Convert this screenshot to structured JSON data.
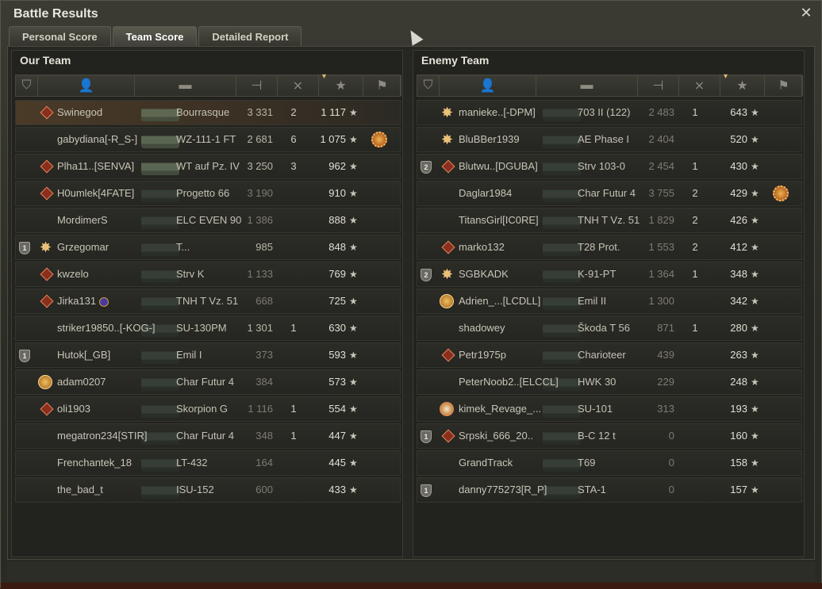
{
  "window": {
    "title": "Battle Results",
    "close_label": "✕"
  },
  "tabs": [
    {
      "label": "Personal Score"
    },
    {
      "label": "Team Score",
      "active": true
    },
    {
      "label": "Detailed Report"
    }
  ],
  "columns": {
    "sort_indicator": "▾",
    "icons": [
      "badge-icon",
      "player-icon",
      "tank-icon",
      "damage-icon",
      "kills-icon",
      "score-star-icon",
      "medal-icon"
    ]
  },
  "our_team": {
    "title": "Our Team",
    "rows": [
      {
        "name": "Swinegod",
        "tank": "Bourrasque",
        "xp": "3 331",
        "kills": "2",
        "score": "1 117",
        "icon": "diamond",
        "me": true
      },
      {
        "name": "gabydiana[-R_S-]",
        "tank": "WZ-111-1 FT",
        "xp": "2 681",
        "kills": "6",
        "score": "1 075",
        "medal": true
      },
      {
        "name": "Plha11..[SENVA]",
        "tank": "WT auf Pz. IV",
        "xp": "3 250",
        "kills": "3",
        "score": "962",
        "icon": "diamond"
      },
      {
        "name": "H0umlek[4FATE]",
        "tank": "Progetto 66",
        "xp": "3 190",
        "kills": "",
        "score": "910",
        "icon": "diamond",
        "dim": true
      },
      {
        "name": "MordimerS",
        "tank": "ELC EVEN 90",
        "xp": "1 386",
        "kills": "",
        "score": "888",
        "dim": true
      },
      {
        "name": "Grzegomar",
        "tank": "T...",
        "xp": "985",
        "kills": "",
        "score": "848",
        "badge": "1",
        "icon": "star"
      },
      {
        "name": "kwzelo",
        "tank": "Strv K",
        "xp": "1 133",
        "kills": "",
        "score": "769",
        "icon": "diamond",
        "dim": true
      },
      {
        "name": "Jirka131",
        "tank": "TNH T Vz. 51",
        "xp": "668",
        "kills": "",
        "score": "725",
        "icon": "diamond",
        "clan": true,
        "dim": true
      },
      {
        "name": "striker19850..[-KOG-]",
        "tank": "SU-130PM",
        "xp": "1 301",
        "kills": "1",
        "score": "630"
      },
      {
        "name": "Hutok[_GB]",
        "tank": "Emil I",
        "xp": "373",
        "kills": "",
        "score": "593",
        "badge": "1",
        "dim": true
      },
      {
        "name": "adam0207",
        "tank": "Char Futur 4",
        "xp": "384",
        "kills": "",
        "score": "573",
        "icon": "coin",
        "dim": true
      },
      {
        "name": "oli1903",
        "tank": "Skorpion G",
        "xp": "1 116",
        "kills": "1",
        "score": "554",
        "icon": "diamond",
        "dim": true
      },
      {
        "name": "megatron234[STIR]",
        "tank": "Char Futur 4",
        "xp": "348",
        "kills": "1",
        "score": "447",
        "dim": true
      },
      {
        "name": "Frenchantek_18",
        "tank": "LT-432",
        "xp": "164",
        "kills": "",
        "score": "445",
        "dim": true
      },
      {
        "name": "the_bad_t",
        "tank": "ISU-152",
        "xp": "600",
        "kills": "",
        "score": "433",
        "dim": true
      }
    ]
  },
  "enemy_team": {
    "title": "Enemy Team",
    "rows": [
      {
        "name": "manieke..[-DPM]",
        "tank": "703 II (122)",
        "xp": "2 483",
        "kills": "1",
        "score": "643",
        "icon": "star",
        "dim": true
      },
      {
        "name": "BluBBer1939",
        "tank": "AE Phase I",
        "xp": "2 404",
        "kills": "",
        "score": "520",
        "icon": "star",
        "dim": true
      },
      {
        "name": "Blutwu..[DGUBA]",
        "tank": "Strv 103-0",
        "xp": "2 454",
        "kills": "1",
        "score": "430",
        "badge": "2",
        "icon": "diamond",
        "dim": true
      },
      {
        "name": "Daglar1984",
        "tank": "Char Futur 4",
        "xp": "3 755",
        "kills": "2",
        "score": "429",
        "medal": true,
        "dim": true
      },
      {
        "name": "TitansGirl[IC0RE]",
        "tank": "TNH T Vz. 51",
        "xp": "1 829",
        "kills": "2",
        "score": "426",
        "dim": true
      },
      {
        "name": "marko132",
        "tank": "T28 Prot.",
        "xp": "1 553",
        "kills": "2",
        "score": "412",
        "icon": "diamond",
        "dim": true
      },
      {
        "name": "SGBKADK",
        "tank": "K-91-PT",
        "xp": "1 364",
        "kills": "1",
        "score": "348",
        "badge": "2",
        "icon": "star",
        "dim": true
      },
      {
        "name": "Adrien_...[LCDLL]",
        "tank": "Emil II",
        "xp": "1 300",
        "kills": "",
        "score": "342",
        "icon": "coin",
        "dim": true
      },
      {
        "name": "shadowey",
        "tank": "Škoda T 56",
        "xp": "871",
        "kills": "1",
        "score": "280",
        "dim": true
      },
      {
        "name": "Petr1975p",
        "tank": "Charioteer",
        "xp": "439",
        "kills": "",
        "score": "263",
        "icon": "diamond",
        "dim": true
      },
      {
        "name": "PeterNoob2..[ELCCL]",
        "tank": "HWK 30",
        "xp": "229",
        "kills": "",
        "score": "248",
        "dim": true
      },
      {
        "name": "kimek_Revage_...",
        "tank": "SU-101",
        "xp": "313",
        "kills": "",
        "score": "193",
        "icon": "coin2",
        "dim": true
      },
      {
        "name": "Srpski_666_20..",
        "tank": "B-C 12 t",
        "xp": "0",
        "kills": "",
        "score": "160",
        "badge": "1",
        "icon": "diamond",
        "dim": true
      },
      {
        "name": "GrandTrack",
        "tank": "T69",
        "xp": "0",
        "kills": "",
        "score": "158",
        "dim": true
      },
      {
        "name": "danny775273[R_P]",
        "tank": "STA-1",
        "xp": "0",
        "kills": "",
        "score": "157",
        "badge": "1",
        "dim": true
      }
    ]
  }
}
